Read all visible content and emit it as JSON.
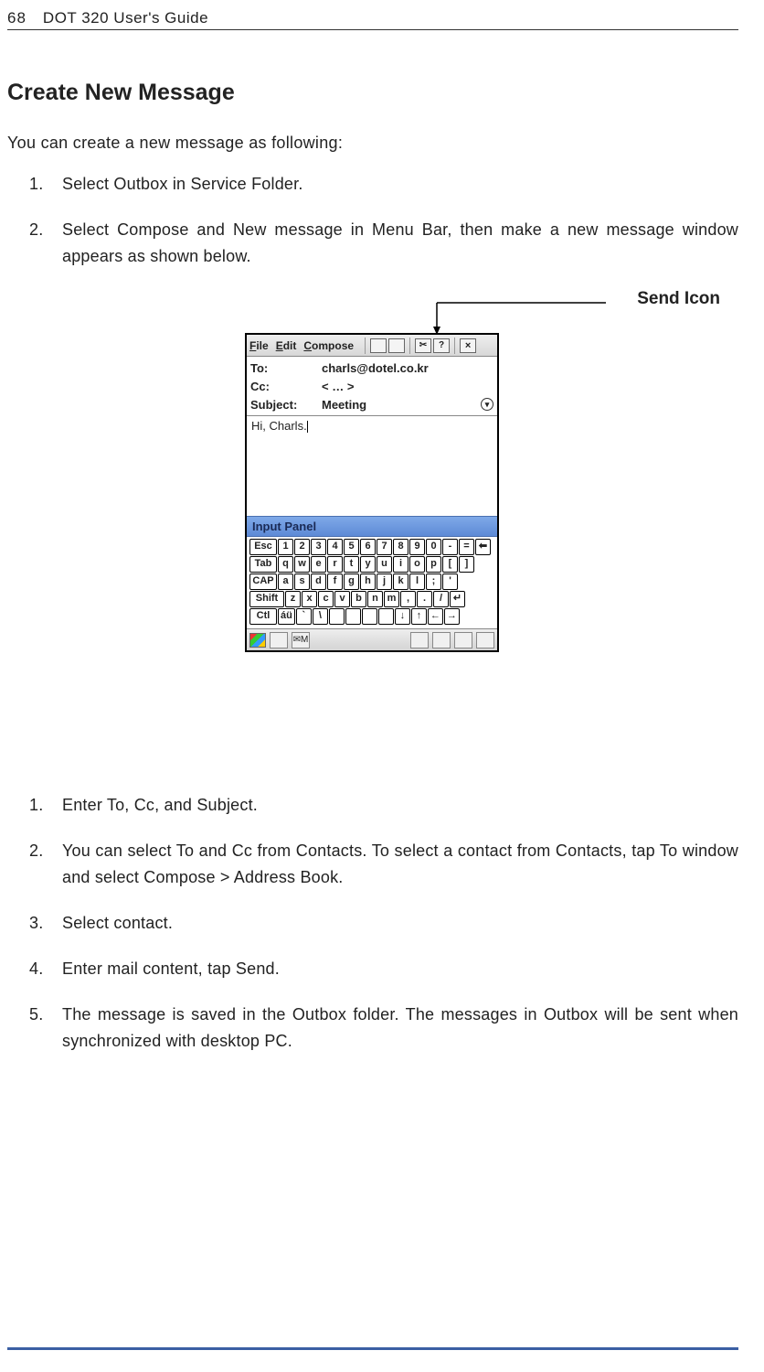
{
  "header": {
    "page_number": "68",
    "guide_title": "DOT 320 User's Guide"
  },
  "section": {
    "title": "Create New Message",
    "intro": "You can create a new message as following:"
  },
  "steps_a": [
    {
      "n": "1.",
      "t": "Select Outbox in Service Folder."
    },
    {
      "n": "2.",
      "t": "Select Compose and New message in Menu Bar, then make a new message window appears as shown below."
    }
  ],
  "callout": {
    "label": "Send Icon"
  },
  "screenshot": {
    "menus": {
      "file": "File",
      "edit": "Edit",
      "compose": "Compose"
    },
    "toolbar_icons": [
      "send-icon",
      "window-icon",
      "cut-icon",
      "help-icon",
      "close-icon"
    ],
    "fields": {
      "to_label": "To:",
      "to_value": "charls@dotel.co.kr",
      "cc_label": "Cc:",
      "cc_value": "< … >",
      "subject_label": "Subject:",
      "subject_value": "Meeting"
    },
    "body_text": "Hi, Charls.",
    "input_panel_label": "Input Panel",
    "keyboard": {
      "r1": [
        "Esc",
        "1",
        "2",
        "3",
        "4",
        "5",
        "6",
        "7",
        "8",
        "9",
        "0",
        "-",
        "=",
        "⬅"
      ],
      "r2": [
        "Tab",
        "q",
        "w",
        "e",
        "r",
        "t",
        "y",
        "u",
        "i",
        "o",
        "p",
        "[",
        "]"
      ],
      "r3": [
        "CAP",
        "a",
        "s",
        "d",
        "f",
        "g",
        "h",
        "j",
        "k",
        "l",
        ";",
        "'"
      ],
      "r4": [
        "Shift",
        "z",
        "x",
        "c",
        "v",
        "b",
        "n",
        "m",
        ",",
        ".",
        "/",
        "↵"
      ],
      "r5": [
        "Ctl",
        "áü",
        "`",
        "\\",
        "",
        "",
        "",
        "",
        "↓",
        "↑",
        "←",
        "→"
      ]
    },
    "taskbar_items": [
      "start-flag",
      "input-icon",
      "mail-m",
      "",
      "net-icon",
      "speaker-icon",
      "keyboard-icon",
      "desktop-icon"
    ],
    "mail_m": "M"
  },
  "steps_b": [
    {
      "n": "1.",
      "t": "Enter To, Cc, and Subject."
    },
    {
      "n": "2.",
      "t": "You can select To and Cc from Contacts. To select a contact from Contacts, tap To window and select Compose > Address Book."
    },
    {
      "n": "3.",
      "t": "Select contact."
    },
    {
      "n": "4.",
      "t": "Enter mail content, tap Send."
    },
    {
      "n": "5.",
      "t": "The message is saved in the Outbox folder. The messages in Outbox will be sent when synchronized with desktop PC."
    }
  ]
}
